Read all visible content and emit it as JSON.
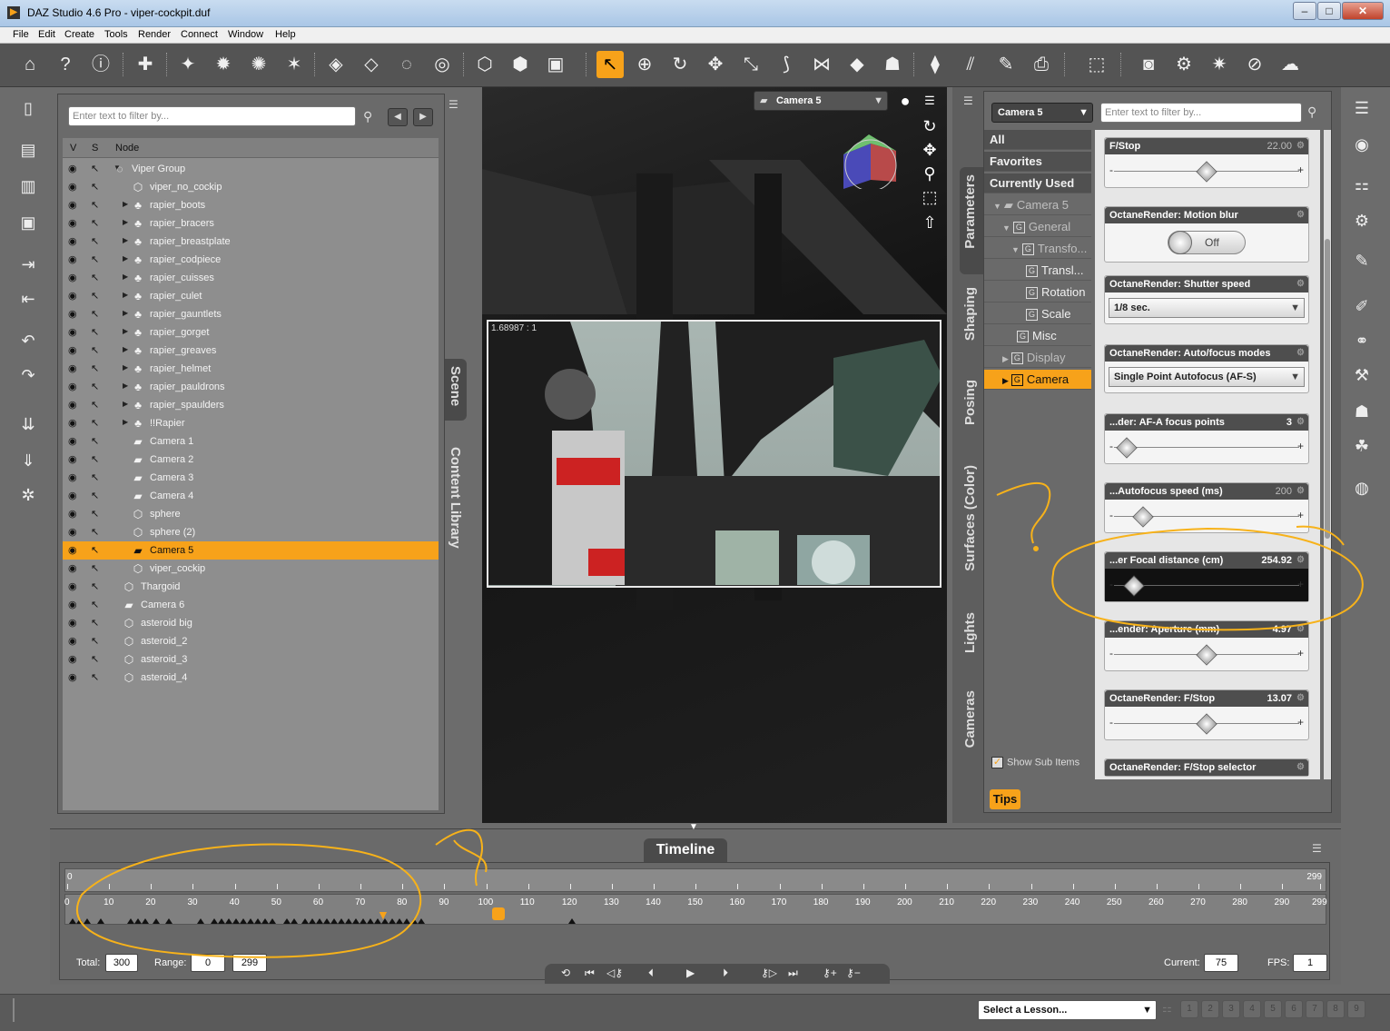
{
  "window": {
    "title": "DAZ Studio 4.6 Pro - viper-cockpit.duf",
    "app_icon": "daz-logo-icon",
    "controls": [
      "minimize",
      "maximize",
      "close"
    ]
  },
  "menu": [
    "File",
    "Edit",
    "Create",
    "Tools",
    "Render",
    "Connect",
    "Window",
    "Help"
  ],
  "scene": {
    "filter_placeholder": "Enter text to filter by...",
    "columns": {
      "v": "V",
      "s": "S",
      "node": "Node"
    },
    "tab_label": "Scene",
    "content_library_label": "Content Library",
    "nodes": [
      {
        "label": "Viper Group",
        "depth": 0,
        "expander": "open",
        "icon": "group-icon"
      },
      {
        "label": "viper_no_cockip",
        "depth": 1,
        "expander": "",
        "icon": "mesh-icon"
      },
      {
        "label": "rapier_boots",
        "depth": 1,
        "expander": "closed",
        "icon": "figure-icon"
      },
      {
        "label": "rapier_bracers",
        "depth": 1,
        "expander": "closed",
        "icon": "figure-icon"
      },
      {
        "label": "rapier_breastplate",
        "depth": 1,
        "expander": "closed",
        "icon": "figure-icon"
      },
      {
        "label": "rapier_codpiece",
        "depth": 1,
        "expander": "closed",
        "icon": "figure-icon"
      },
      {
        "label": "rapier_cuisses",
        "depth": 1,
        "expander": "closed",
        "icon": "figure-icon"
      },
      {
        "label": "rapier_culet",
        "depth": 1,
        "expander": "closed",
        "icon": "figure-icon"
      },
      {
        "label": "rapier_gauntlets",
        "depth": 1,
        "expander": "closed",
        "icon": "figure-icon"
      },
      {
        "label": "rapier_gorget",
        "depth": 1,
        "expander": "closed",
        "icon": "figure-icon"
      },
      {
        "label": "rapier_greaves",
        "depth": 1,
        "expander": "closed",
        "icon": "figure-icon"
      },
      {
        "label": "rapier_helmet",
        "depth": 1,
        "expander": "closed",
        "icon": "figure-icon"
      },
      {
        "label": "rapier_pauldrons",
        "depth": 1,
        "expander": "closed",
        "icon": "figure-icon"
      },
      {
        "label": "rapier_spaulders",
        "depth": 1,
        "expander": "closed",
        "icon": "figure-icon"
      },
      {
        "label": "!!Rapier",
        "depth": 1,
        "expander": "closed",
        "icon": "figure-icon"
      },
      {
        "label": "Camera 1",
        "depth": 1,
        "expander": "",
        "icon": "camera-icon"
      },
      {
        "label": "Camera 2",
        "depth": 1,
        "expander": "",
        "icon": "camera-icon"
      },
      {
        "label": "Camera 3",
        "depth": 1,
        "expander": "",
        "icon": "camera-icon"
      },
      {
        "label": "Camera 4",
        "depth": 1,
        "expander": "",
        "icon": "camera-icon"
      },
      {
        "label": "sphere",
        "depth": 1,
        "expander": "",
        "icon": "mesh-icon"
      },
      {
        "label": "sphere (2)",
        "depth": 1,
        "expander": "",
        "icon": "mesh-icon"
      },
      {
        "label": "Camera 5",
        "depth": 1,
        "expander": "",
        "icon": "camera-icon",
        "selected": true
      },
      {
        "label": "viper_cockip",
        "depth": 1,
        "expander": "",
        "icon": "mesh-icon"
      },
      {
        "label": "Thargoid",
        "depth": 0,
        "expander": "",
        "icon": "mesh-icon"
      },
      {
        "label": "Camera 6",
        "depth": 0,
        "expander": "",
        "icon": "camera-icon"
      },
      {
        "label": "asteroid big",
        "depth": 0,
        "expander": "",
        "icon": "mesh-icon"
      },
      {
        "label": "asteroid_2",
        "depth": 0,
        "expander": "",
        "icon": "mesh-icon"
      },
      {
        "label": "asteroid_3",
        "depth": 0,
        "expander": "",
        "icon": "mesh-icon"
      },
      {
        "label": "asteroid_4",
        "depth": 0,
        "expander": "",
        "icon": "mesh-icon"
      }
    ]
  },
  "viewport": {
    "camera": "Camera 5",
    "aspect_ratio_label": "1.68987 : 1"
  },
  "parameters": {
    "camera_select": "Camera 5",
    "filter_placeholder": "Enter text to filter by...",
    "side_tabs": [
      "Parameters",
      "Shaping",
      "Posing",
      "Surfaces (Color)",
      "Lights",
      "Cameras"
    ],
    "tree": [
      {
        "label": "All",
        "style": "hdr"
      },
      {
        "label": "Favorites",
        "style": "hdr"
      },
      {
        "label": "Currently Used",
        "style": "hdr"
      },
      {
        "label": "Camera 5",
        "style": "dim",
        "prefix": "▼",
        "icon": "camera"
      },
      {
        "label": "General",
        "style": "dim",
        "prefix": "▼",
        "icon": "G"
      },
      {
        "label": "Transfo...",
        "style": "dim",
        "prefix": "▼",
        "icon": "G"
      },
      {
        "label": "Transl...",
        "style": "",
        "prefix": "",
        "icon": "G"
      },
      {
        "label": "Rotation",
        "style": "",
        "prefix": "",
        "icon": "G"
      },
      {
        "label": "Scale",
        "style": "",
        "prefix": "",
        "icon": "G"
      },
      {
        "label": "Misc",
        "style": "",
        "prefix": "",
        "icon": "G"
      },
      {
        "label": "Display",
        "style": "dim",
        "prefix": "▶",
        "icon": "G"
      },
      {
        "label": "Camera",
        "style": "sel",
        "prefix": "▶",
        "icon": "G"
      }
    ],
    "show_sub_items": "Show Sub Items",
    "tips": "Tips",
    "cards": [
      {
        "title": "F/Stop",
        "value": "22.00",
        "value_dim": true,
        "kind": "slider",
        "knob": 0.5
      },
      {
        "title": "OctaneRender: Motion blur",
        "value": "",
        "kind": "toggle",
        "toggle_label": "Off"
      },
      {
        "title": "OctaneRender: Shutter speed",
        "value": "",
        "kind": "select",
        "option": "1/8 sec."
      },
      {
        "title": "OctaneRender: Auto/focus modes",
        "value": "",
        "kind": "select",
        "option": "Single Point Autofocus (AF-S)"
      },
      {
        "title": "...der: AF-A focus points",
        "value": "3",
        "value_dim": false,
        "kind": "slider",
        "knob": 0.06
      },
      {
        "title": "...Autofocus speed (ms)",
        "value": "200",
        "value_dim": true,
        "kind": "slider",
        "knob": 0.15
      },
      {
        "title": "...er Focal distance (cm)",
        "value": "254.92",
        "value_dim": false,
        "kind": "slider-dark",
        "knob": 0.1
      },
      {
        "title": "...ender: Aperture (mm)",
        "value": "4.97",
        "value_dim": false,
        "kind": "slider",
        "knob": 0.5
      },
      {
        "title": "OctaneRender: F/Stop",
        "value": "13.07",
        "value_dim": false,
        "kind": "slider",
        "knob": 0.5
      },
      {
        "title": "OctaneRender: F/Stop selector",
        "value": "",
        "kind": "header-only"
      }
    ]
  },
  "timeline": {
    "tab": "Timeline",
    "scrub_start": "0",
    "scrub_end": "299",
    "ruler_labels": [
      "0",
      "10",
      "20",
      "30",
      "40",
      "50",
      "60",
      "70",
      "80",
      "90",
      "100",
      "110",
      "120",
      "130",
      "140",
      "150",
      "160",
      "170",
      "180",
      "190",
      "200",
      "210",
      "220",
      "230",
      "240",
      "250",
      "260",
      "270",
      "280",
      "290",
      "299"
    ],
    "total_label": "Total:",
    "total_value": "300",
    "range_label": "Range:",
    "range_start": "0",
    "range_end": "299",
    "current_label": "Current:",
    "current_value": "75",
    "fps_label": "FPS:",
    "fps_value": "1"
  },
  "statusbar": {
    "lesson_select": "Select a Lesson...",
    "lesson_steps": [
      "1",
      "2",
      "3",
      "4",
      "5",
      "6",
      "7",
      "8",
      "9"
    ]
  },
  "colors": {
    "accent": "#f7a21a",
    "panel": "#6a6a6a",
    "toolbar": "#545454"
  }
}
